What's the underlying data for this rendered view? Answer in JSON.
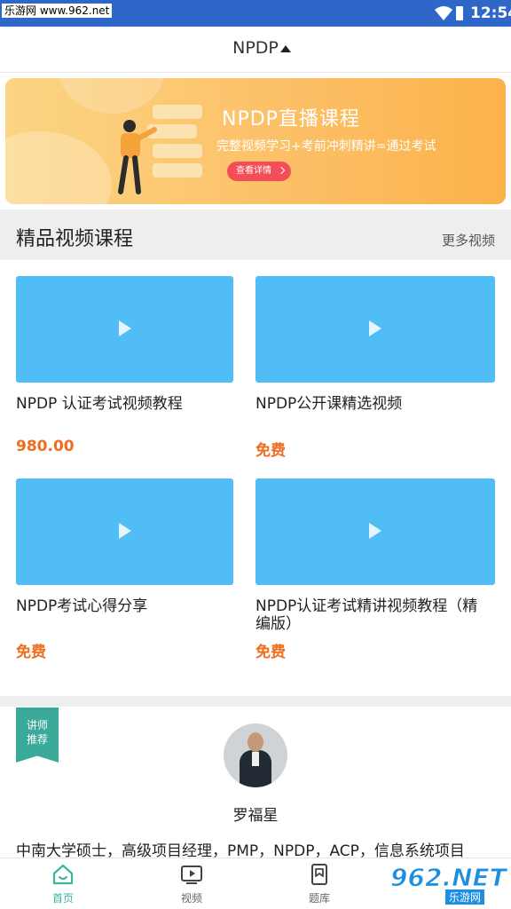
{
  "status_bar": {
    "watermark": "乐游网 www.962.net",
    "time": "12:54"
  },
  "header": {
    "title": "NPDP"
  },
  "banner": {
    "headline": "NPDP直播课程",
    "subtitle": "完整视频学习+考前冲刺精讲=通过考试",
    "button_label": "查看详情"
  },
  "section": {
    "title": "精品视频课程",
    "more_label": "更多视频"
  },
  "videos": [
    {
      "name": "NPDP 认证考试视频教程",
      "price": "980.00"
    },
    {
      "name": "NPDP公开课精选视频",
      "price": "免费"
    },
    {
      "name": "NPDP考试心得分享",
      "price": "免费"
    },
    {
      "name_line1": "NPDP认证考试精讲视频教程（精",
      "name_line2": "编版）",
      "price": "免费"
    }
  ],
  "teacher": {
    "ribbon_line1": "讲师",
    "ribbon_line2": "推荐",
    "name": "罗福星",
    "description": "中南大学硕士，高级项目经理，PMP，NPDP，ACP，信息系统项目"
  },
  "tabbar": {
    "tabs": [
      {
        "label": "首页",
        "icon": "home-icon"
      },
      {
        "label": "视频",
        "icon": "video-icon"
      },
      {
        "label": "题库",
        "icon": "question-bank-icon"
      }
    ]
  },
  "bottom_watermark": {
    "big": "962.NET",
    "small": "乐游网"
  },
  "colors": {
    "status_bar": "#2f67c8",
    "accent": "#3bb39f",
    "price": "#ef6d1f",
    "thumbnail": "#50bdf7"
  }
}
